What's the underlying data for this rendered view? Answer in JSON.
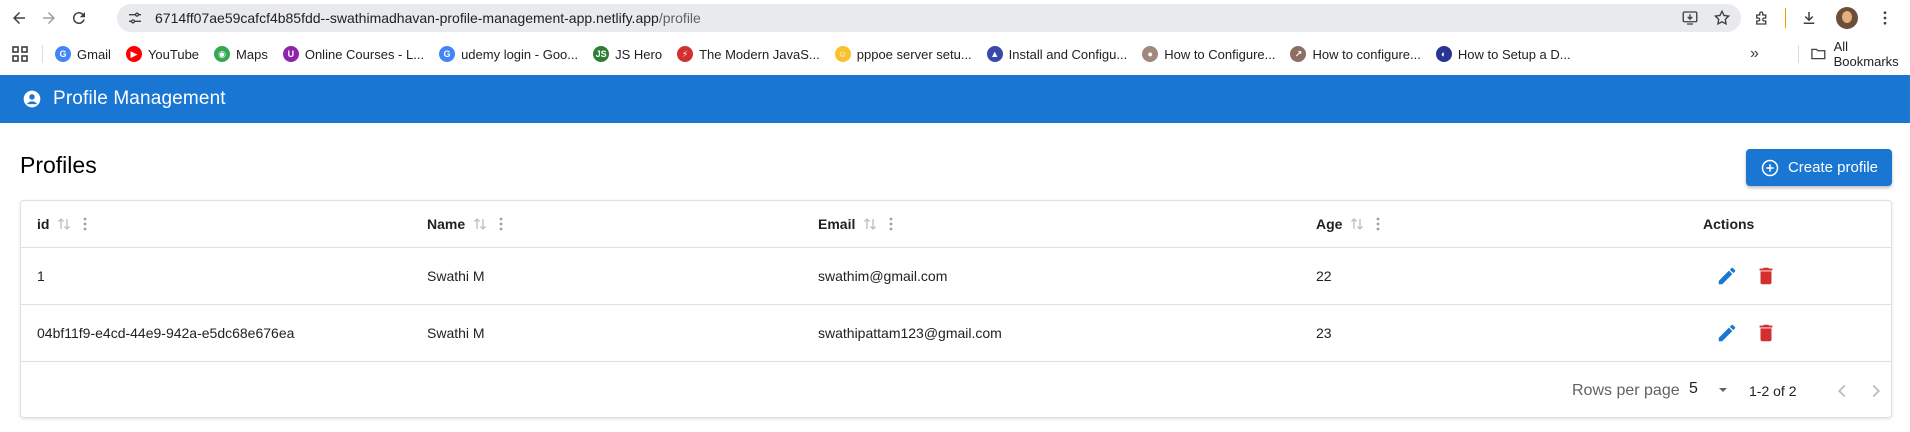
{
  "browser": {
    "url_host": "6714ff07ae59cafcf4b85fdd--swathimadhavan-profile-management-app.netlify.app",
    "url_path": "/profile",
    "bookmarks": [
      {
        "label": "Gmail",
        "color": "#4285f4",
        "glyph": "G"
      },
      {
        "label": "YouTube",
        "color": "#ff0000",
        "glyph": "▶"
      },
      {
        "label": "Maps",
        "color": "#34a853",
        "glyph": "◉"
      },
      {
        "label": "Online Courses - L...",
        "color": "#8e24aa",
        "glyph": "U"
      },
      {
        "label": "udemy login - Goo...",
        "color": "#4285f4",
        "glyph": "G"
      },
      {
        "label": "JS Hero",
        "color": "#2e7d32",
        "glyph": "JS"
      },
      {
        "label": "The Modern JavaS...",
        "color": "#d32f2f",
        "glyph": "⚡"
      },
      {
        "label": "pppoe server setu...",
        "color": "#fbc02d",
        "glyph": "☺"
      },
      {
        "label": "Install and Configu...",
        "color": "#3949ab",
        "glyph": "▲"
      },
      {
        "label": "How to Configure...",
        "color": "#a1887f",
        "glyph": "●"
      },
      {
        "label": "How to configure...",
        "color": "#8d6e63",
        "glyph": "↗"
      },
      {
        "label": "How to Setup a D...",
        "color": "#283593",
        "glyph": "◐"
      }
    ],
    "more_glyph": "»",
    "all_bookmarks": "All Bookmarks"
  },
  "app": {
    "title": "Profile Management",
    "page_title": "Profiles",
    "create_label": "Create profile"
  },
  "table": {
    "columns": [
      "id",
      "Name",
      "Email",
      "Age",
      "Actions"
    ],
    "rows": [
      {
        "id": "1",
        "name": "Swathi M",
        "email": "swathim@gmail.com",
        "age": "22"
      },
      {
        "id": "04bf11f9-e4cd-44e9-942a-e5dc68e676ea",
        "name": "Swathi M",
        "email": "swathipattam123@gmail.com",
        "age": "23"
      }
    ],
    "footer": {
      "rows_per_page_label": "Rows per page",
      "rows_per_page_value": "5",
      "range": "1-2 of 2"
    }
  },
  "colors": {
    "primary": "#1976d2",
    "edit": "#1976d2",
    "delete": "#d32f2f"
  },
  "icons": {
    "edit": "pencil-icon",
    "delete": "trash-icon",
    "sort": "sort-arrows-icon",
    "column_menu": "vertical-dots-icon",
    "create": "add-circle-icon",
    "account": "account-circle-icon"
  }
}
